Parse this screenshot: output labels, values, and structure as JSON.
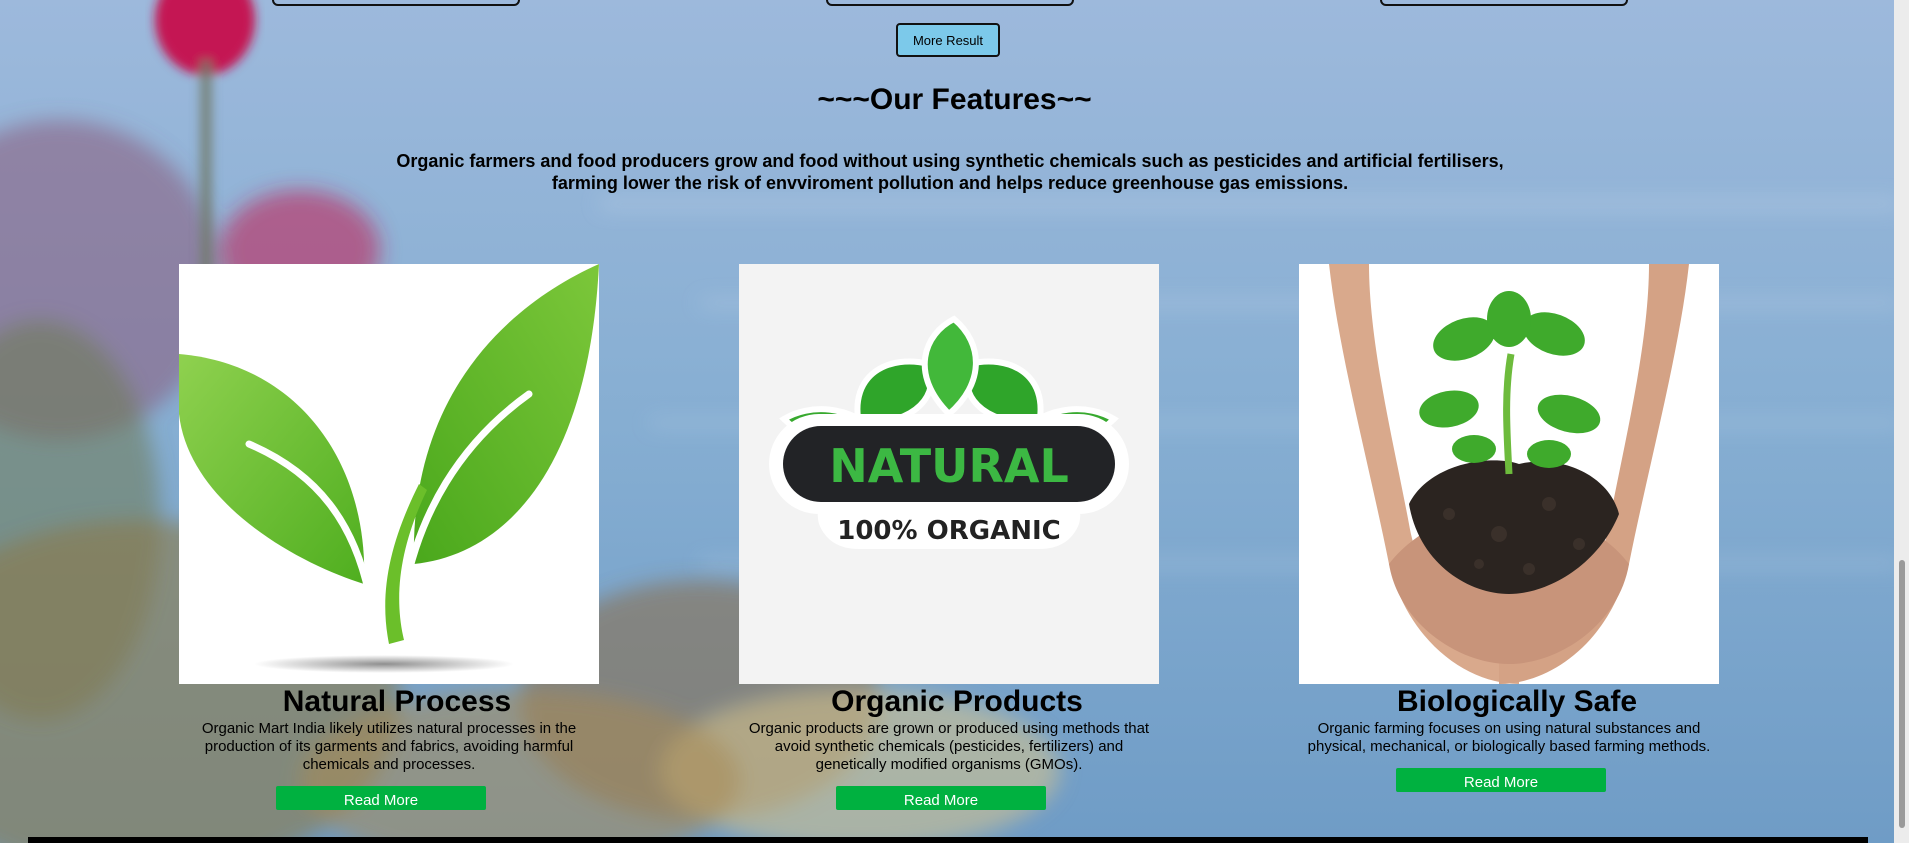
{
  "more_result": {
    "label": "More Result"
  },
  "features": {
    "title": "~~~Our Features~~",
    "intro_line1": "Organic farmers and food producers grow and food without using synthetic chemicals such as pesticides and artificial fertilisers,",
    "intro_line2": "farming lower the risk of envviroment pollution and helps reduce greenhouse gas emissions.",
    "cards": [
      {
        "title": "Natural Process",
        "description": "Organic Mart India likely utilizes natural processes in the production of its garments and fabrics, avoiding harmful chemicals and processes.",
        "button": "Read More",
        "image_icon": "green-leaves-icon"
      },
      {
        "title": "Organic Products",
        "description": "Organic products are grown or produced using methods that avoid synthetic chemicals (pesticides, fertilizers) and genetically modified organisms (GMOs).",
        "button": "Read More",
        "image_icon": "natural-organic-badge-icon",
        "badge_text": "NATURAL",
        "badge_subtext": "100% ORGANIC"
      },
      {
        "title": "Biologically Safe",
        "description": "Organic farming focuses on using natural substances and physical, mechanical, or biologically based farming methods.",
        "button": "Read More",
        "image_icon": "hands-holding-seedling-icon"
      }
    ]
  },
  "colors": {
    "read_more_bg": "#00b140",
    "more_result_bg": "#7cc9ea"
  }
}
